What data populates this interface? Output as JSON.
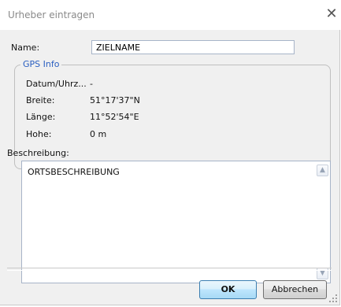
{
  "window": {
    "title": "Urheber eintragen",
    "close_glyph": "✕"
  },
  "form": {
    "name_label": "Name:",
    "name_value": "ZIELNAME"
  },
  "gps_info": {
    "legend": "GPS Info",
    "fields": [
      {
        "label": "Datum/Uhrz...",
        "value": "-"
      },
      {
        "label": "Breite:",
        "value": "51°17'37\"N"
      },
      {
        "label": "Länge:",
        "value": "11°52'54\"E"
      },
      {
        "label": "Hohe:",
        "value": "0 m"
      }
    ]
  },
  "description": {
    "label": "Beschreibung:",
    "value": "ORTSBESCHREIBUNG"
  },
  "buttons": {
    "ok": "OK",
    "cancel": "Abbrechen"
  },
  "icons": {
    "close": "close-icon",
    "scroll_up": "scroll-up-arrow-icon",
    "scroll_down": "scroll-down-arrow-icon",
    "resize": "resize-grip-icon"
  },
  "colors": {
    "legend": "#2a5fc1",
    "dialog_bg": "#f0f0f0",
    "ok_button": "#bee6fd"
  }
}
